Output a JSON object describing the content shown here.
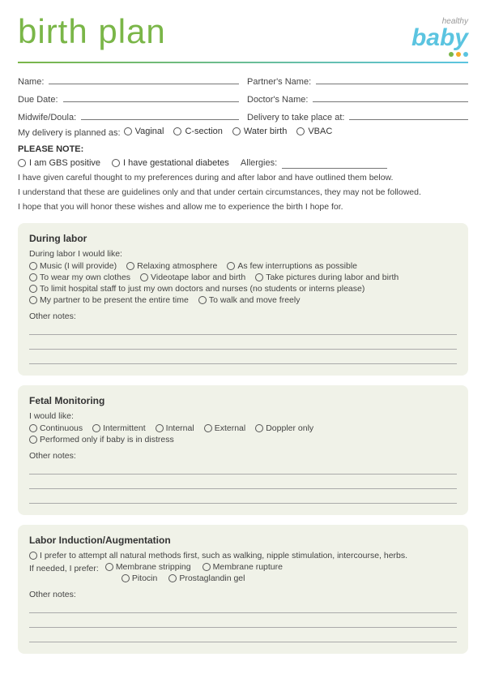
{
  "header": {
    "title": "birth plan",
    "logo_healthy": "healthy",
    "logo_baby": "baby",
    "dots": [
      "#7ab648",
      "#f7a928",
      "#5bc4e0"
    ]
  },
  "form": {
    "name_label": "Name:",
    "partners_name_label": "Partner's Name:",
    "due_date_label": "Due Date:",
    "doctors_name_label": "Doctor's Name:",
    "midwife_label": "Midwife/Doula:",
    "delivery_place_label": "Delivery to take place at:",
    "delivery_planned_label": "My delivery is planned as:",
    "delivery_options": [
      "Vaginal",
      "C-section",
      "Water birth",
      "VBAC"
    ]
  },
  "please_note": {
    "heading": "PLEASE NOTE:",
    "gbs_label": "I am GBS positive",
    "diabetes_label": "I have gestational diabetes",
    "allergies_label": "Allergies:"
  },
  "intro_lines": [
    "I have given careful thought to my preferences during and after labor and have outlined them below.",
    "I understand that these are guidelines only and that under certain circumstances, they may not be followed.",
    "I hope that you will honor these wishes and allow me to experience the birth I hope for."
  ],
  "sections": [
    {
      "id": "during-labor",
      "title": "During labor",
      "subtitle": "During labor I would like:",
      "option_rows": [
        [
          "Music (I will provide)",
          "Relaxing atmosphere",
          "As few interruptions as possible"
        ],
        [
          "To wear my own clothes",
          "Videotape labor and birth",
          "Take pictures during labor and birth"
        ],
        [
          "To limit hospital staff to just my own doctors and nurses (no students or interns please)"
        ],
        [
          "My partner to be present the entire time",
          "To walk and move freely"
        ]
      ],
      "other_notes_label": "Other notes:",
      "note_lines": 3
    },
    {
      "id": "fetal-monitoring",
      "title": "Fetal Monitoring",
      "subtitle": "I would like:",
      "option_rows": [
        [
          "Continuous",
          "Intermittent",
          "Internal",
          "External",
          "Doppler only"
        ],
        [
          "Performed only if baby is in distress"
        ]
      ],
      "other_notes_label": "Other notes:",
      "note_lines": 3
    },
    {
      "id": "labor-induction",
      "title": "Labor Induction/Augmentation",
      "subtitle": "",
      "option_rows": [],
      "prefer_natural": "I prefer to attempt all natural methods first, such as walking, nipple stimulation, intercourse, herbs.",
      "if_needed_label": "If needed, I prefer:",
      "if_needed_options": [
        [
          "Membrane stripping",
          "Membrane rupture"
        ],
        [
          "Pitocin",
          "Prostaglandin gel"
        ]
      ],
      "other_notes_label": "Other notes:",
      "note_lines": 3
    }
  ]
}
